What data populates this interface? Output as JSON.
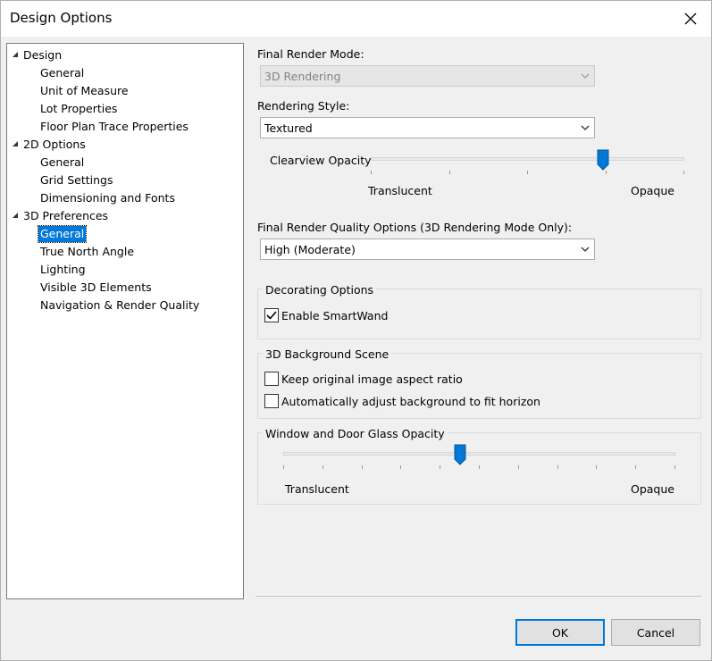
{
  "window": {
    "title": "Design Options"
  },
  "tree": [
    {
      "label": "Design",
      "level": 0,
      "expanded": true
    },
    {
      "label": "General",
      "level": 1
    },
    {
      "label": "Unit of Measure",
      "level": 1
    },
    {
      "label": "Lot Properties",
      "level": 1
    },
    {
      "label": "Floor Plan Trace Properties",
      "level": 1
    },
    {
      "label": "2D Options",
      "level": 0,
      "expanded": true
    },
    {
      "label": "General",
      "level": 1
    },
    {
      "label": "Grid Settings",
      "level": 1
    },
    {
      "label": "Dimensioning and Fonts",
      "level": 1
    },
    {
      "label": "3D Preferences",
      "level": 0,
      "expanded": true
    },
    {
      "label": "General",
      "level": 1,
      "selected": true
    },
    {
      "label": "True North Angle",
      "level": 1
    },
    {
      "label": "Lighting",
      "level": 1
    },
    {
      "label": "Visible 3D Elements",
      "level": 1
    },
    {
      "label": "Navigation & Render Quality",
      "level": 1
    }
  ],
  "final_render_mode": {
    "label": "Final Render Mode:",
    "value": "3D Rendering",
    "disabled": true
  },
  "rendering_style": {
    "label": "Rendering Style:",
    "value": "Textured"
  },
  "clearview_opacity": {
    "label": "Clearview Opacity",
    "min_label": "Translucent",
    "max_label": "Opaque",
    "position": 0.74
  },
  "render_quality": {
    "label": "Final Render Quality Options (3D Rendering Mode Only):",
    "value": "High (Moderate)"
  },
  "decorating": {
    "title": "Decorating Options",
    "smartwand_label": "Enable SmartWand",
    "smartwand_checked": true
  },
  "background_scene": {
    "title": "3D Background Scene",
    "aspect_label": "Keep original image aspect ratio",
    "aspect_checked": false,
    "horizon_label": "Automatically adjust background to fit horizon",
    "horizon_checked": false
  },
  "glass_opacity": {
    "title": "Window and Door Glass Opacity",
    "min_label": "Translucent",
    "max_label": "Opaque",
    "position": 0.45
  },
  "buttons": {
    "ok": "OK",
    "cancel": "Cancel"
  },
  "colors": {
    "accent": "#0078d7",
    "selection": "#0078d7"
  }
}
